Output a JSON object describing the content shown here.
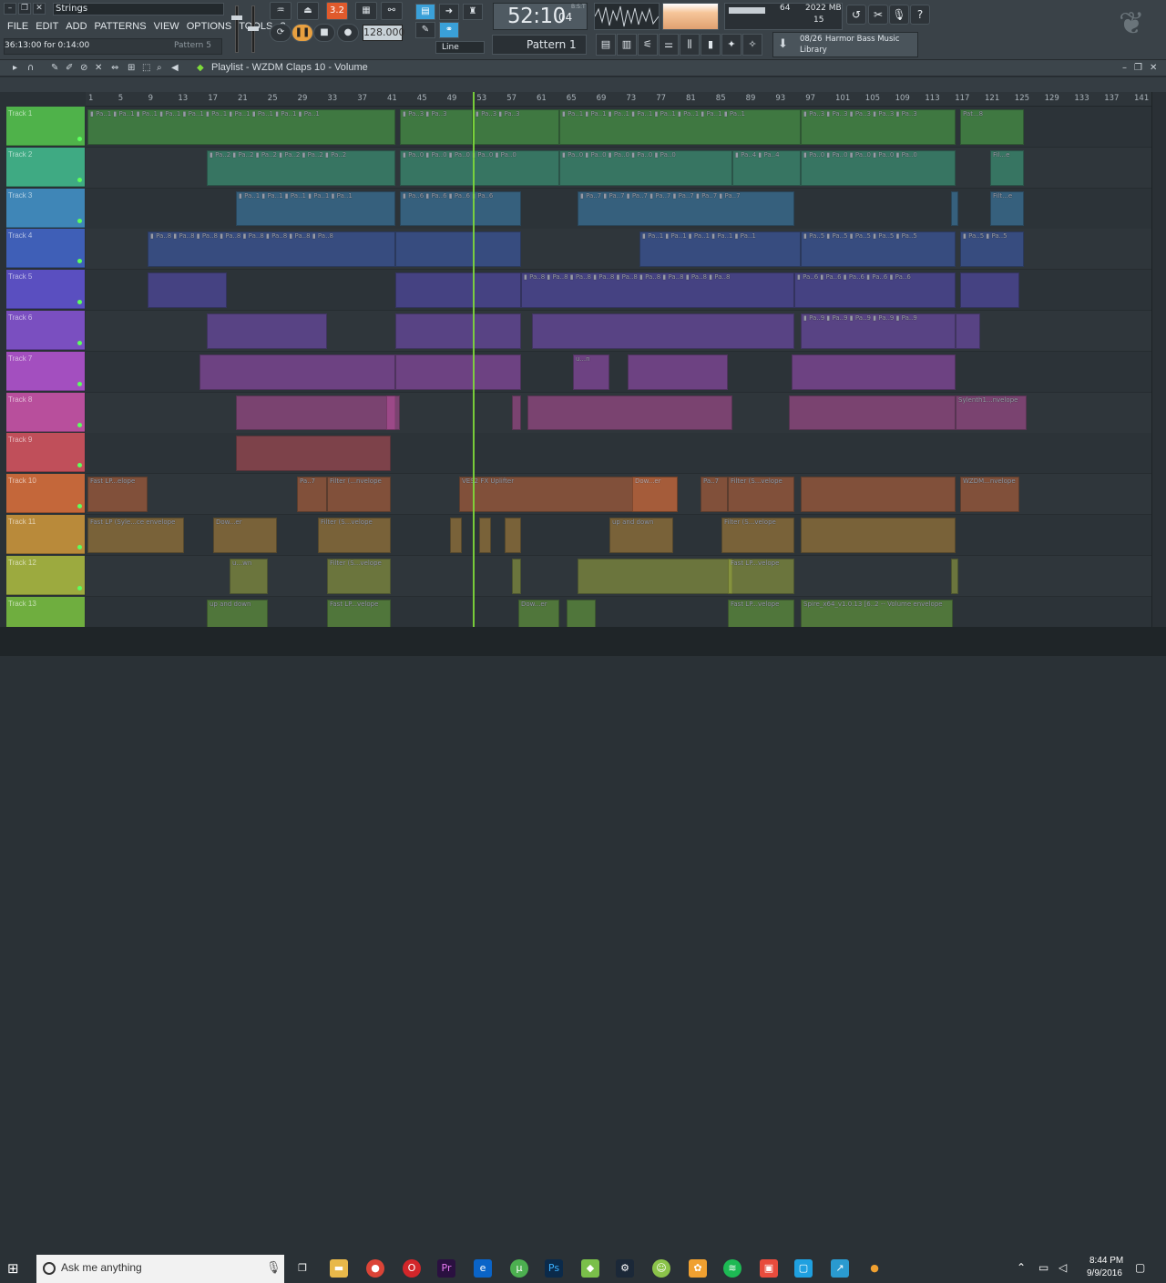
{
  "window": {
    "title": "Strings"
  },
  "menu": [
    "FILE",
    "EDIT",
    "ADD",
    "PATTERNS",
    "VIEW",
    "OPTIONS",
    "TOOLS",
    "?"
  ],
  "hint": {
    "text": "36:13:00 for 0:14:00",
    "pattern": "Pattern 5"
  },
  "transport": {
    "mode": "3.2",
    "tempo": "128.000",
    "snap": "Line"
  },
  "time": {
    "main": "52:10",
    "sub": "04",
    "label": "B:S:T"
  },
  "cpu": {
    "value": "64",
    "memory": "2022 MB",
    "polyphony": "15"
  },
  "pattern_selector": "Pattern 1",
  "news": {
    "date": "08/26",
    "title": "Harmor Bass Music",
    "title2": "Library"
  },
  "playlist": {
    "title": "Playlist - WZDM Claps 10 - Volume"
  },
  "ruler": [
    "1",
    "5",
    "9",
    "13",
    "17",
    "21",
    "25",
    "29",
    "33",
    "37",
    "41",
    "45",
    "49",
    "53",
    "57",
    "61",
    "65",
    "69",
    "73",
    "77",
    "81",
    "85",
    "89",
    "93",
    "97",
    "101",
    "105",
    "109",
    "113",
    "117",
    "121",
    "125",
    "129",
    "133",
    "137",
    "141"
  ],
  "tracks": [
    {
      "name": "Track 1",
      "color": "#4fb24a"
    },
    {
      "name": "Track 2",
      "color": "#3faa83"
    },
    {
      "name": "Track 3",
      "color": "#3f86b7"
    },
    {
      "name": "Track 4",
      "color": "#3f5fb7"
    },
    {
      "name": "Track 5",
      "color": "#5a4fc0"
    },
    {
      "name": "Track 6",
      "color": "#7a4fc0"
    },
    {
      "name": "Track 7",
      "color": "#a34fbf"
    },
    {
      "name": "Track 8",
      "color": "#b84f9c"
    },
    {
      "name": "Track 9",
      "color": "#c04f5a"
    },
    {
      "name": "Track 10",
      "color": "#c4673a"
    },
    {
      "name": "Track 11",
      "color": "#b98a3a"
    },
    {
      "name": "Track 12",
      "color": "#9caa3f"
    },
    {
      "name": "Track 13",
      "color": "#6fae3f"
    }
  ],
  "clip_labels": {
    "c10a": "Fast LP...elope",
    "c10b": "Filter (...nvelope",
    "c10c": "VES2 FX Uplifter",
    "c10d": "Dow...er",
    "c10e": "Filter (S...velope",
    "c10f": "WZDM...nvelope",
    "c10g": "Pa..7",
    "c11a": "Fast LP (Syle...ce envelope",
    "c11b": "Dow...er",
    "c11c": "Filter (S...velope",
    "c11d": "up and down",
    "c11e": "Filter (S...velope",
    "c12a": "u...wn",
    "c12b": "Filter (S...velope",
    "c12c": "Fast LP...velope",
    "c13a": "up and down",
    "c13b": "Fast LP...velope",
    "c13c": "Dow...er",
    "c13d": "Fast LP...velope",
    "c13e": "Spire_x64_v1.0.13 [6..2 -- Volume envelope",
    "c8a": "Sylenth1...nvelope",
    "c3a": "Filt...e",
    "c2a": "Fil...e",
    "c1a": "Pat...8",
    "c7a": "u...n"
  },
  "taskbar": {
    "search": "Ask me anything",
    "time": "8:44 PM",
    "date": "9/9/2016"
  }
}
